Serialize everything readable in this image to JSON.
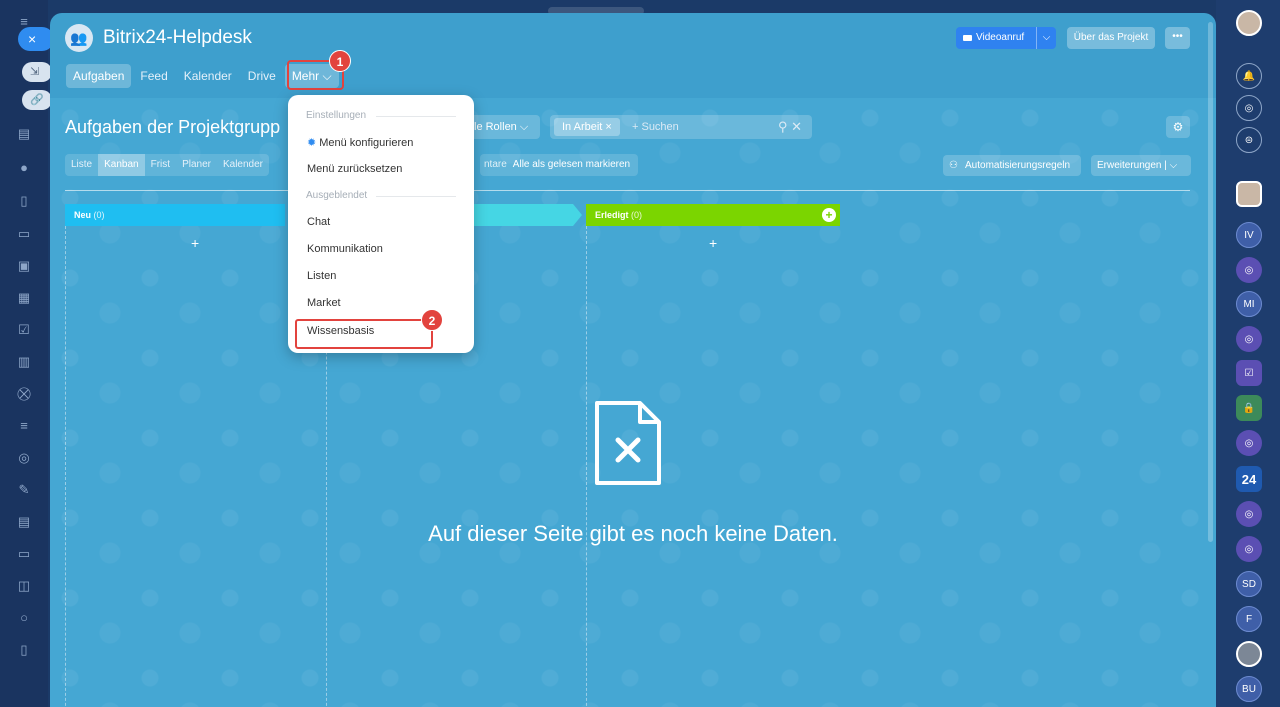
{
  "window": {
    "close_label": "×"
  },
  "side_pills": [
    "⇲",
    "🔗"
  ],
  "header": {
    "title": "Bitrix24-Helpdesk",
    "video_call": "Videoanruf",
    "about": "Über das Projekt",
    "more": "•••"
  },
  "nav": {
    "tabs": [
      "Aufgaben",
      "Feed",
      "Kalender",
      "Drive",
      "Mehr ⌵"
    ]
  },
  "page": {
    "title": "Aufgaben der Projektgrupp",
    "roles": "le Rollen ⌵",
    "filter_chip": "In Arbeit ×",
    "search_placeholder": "+ Suchen",
    "search_icons": "⚲ ✕"
  },
  "views": [
    "Liste",
    "Kanban",
    "Frist",
    "Planer",
    "Kalender"
  ],
  "toolbar": {
    "mark_read_prefix": "ntare",
    "mark_read": "Alle als gelesen markieren",
    "automation": "Automatisierungsregeln",
    "extensions": "Erweiterungen | ⌵"
  },
  "kanban": {
    "columns": [
      {
        "name": "Neu",
        "count": "(0)"
      },
      {
        "name": "Erledigt",
        "count": "(0)"
      }
    ]
  },
  "empty_state": {
    "text": "Auf dieser Seite gibt es noch keine Daten."
  },
  "menu": {
    "section_settings": "Einstellungen",
    "configure": "Menü konfigurieren",
    "reset": "Menü zurücksetzen",
    "section_hidden": "Ausgeblendet",
    "items": [
      "Chat",
      "Kommunikation",
      "Listen",
      "Market",
      "Wissensbasis"
    ]
  },
  "callouts": [
    "1",
    "2"
  ],
  "right_rail": {
    "badges": [
      "IV",
      "MI",
      "24",
      "SD",
      "F",
      "BU"
    ]
  },
  "colors": {
    "panel": "#3e9fcd",
    "accent": "#2f8cf0",
    "callout": "#e2433e",
    "done": "#7bd500",
    "new": "#1fbef1"
  }
}
